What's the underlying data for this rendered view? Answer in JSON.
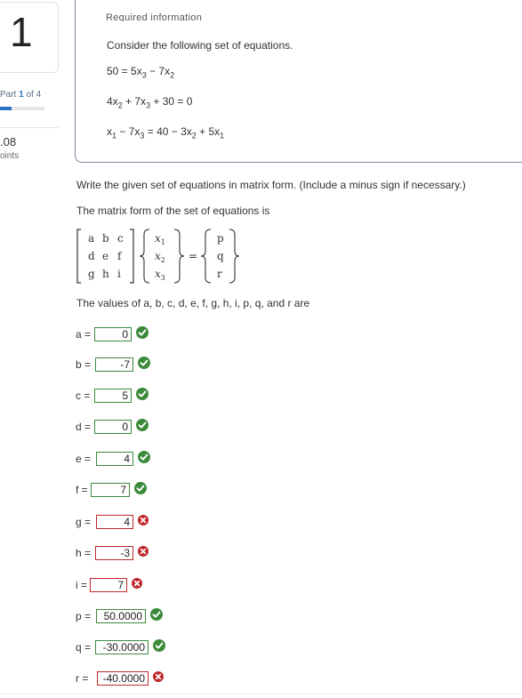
{
  "sidebar": {
    "question_number": "1",
    "part_word": "Part",
    "part_current": "1",
    "part_of": "of 4",
    "progress_fraction": 0.25,
    "points_value": ".08",
    "points_label": "oints"
  },
  "info": {
    "header": "Required information",
    "intro": "Consider the following set of equations.",
    "equations": {
      "eq1": {
        "lhs": "50 = 5x",
        "s1": "3",
        "mid": " − 7x",
        "s2": "2"
      },
      "eq2": {
        "a": "4x",
        "s1": "2",
        "b": " + 7x",
        "s2": "3",
        "c": " + 30 = 0"
      },
      "eq3": {
        "a": "x",
        "s1": "1",
        "b": " − 7x",
        "s2": "3",
        "c": " = 40 − 3x",
        "s3": "2",
        "d": " + 5x",
        "s4": "1"
      }
    }
  },
  "question": {
    "instruction": "Write the given set of equations in matrix form. (Include a minus sign if necessary.)",
    "matrix_intro": "The matrix form of the set of equations is",
    "values_prompt": "The values of a, b, c, d, e, f, g, h, i, p, q, and r are"
  },
  "matrix": {
    "coeffs": [
      "a",
      "b",
      "c",
      "d",
      "e",
      "f",
      "g",
      "h",
      "i"
    ],
    "vars": [
      {
        "v": "x",
        "s": "1"
      },
      {
        "v": "x",
        "s": "2"
      },
      {
        "v": "x",
        "s": "3"
      }
    ],
    "equals": "=",
    "rhs": [
      "p",
      "q",
      "r"
    ]
  },
  "answers": [
    {
      "label": "a =",
      "value": "0",
      "correct": true
    },
    {
      "label": "b =",
      "value": "-7",
      "correct": true
    },
    {
      "label": "c =",
      "value": "5",
      "correct": true
    },
    {
      "label": "d =",
      "value": "0",
      "correct": true
    },
    {
      "label": "e =",
      "value": "4",
      "correct": true
    },
    {
      "label": "f =",
      "value": "7",
      "correct": true
    },
    {
      "label": "g =",
      "value": "4",
      "correct": false
    },
    {
      "label": "h =",
      "value": "-3",
      "correct": false
    },
    {
      "label": "i =",
      "value": "7",
      "correct": false
    },
    {
      "label": "p =",
      "value": "50.0000",
      "correct": true
    },
    {
      "label": "q =",
      "value": "-30.0000",
      "correct": true
    },
    {
      "label": "r =",
      "value": "-40.0000",
      "correct": false
    }
  ],
  "colors": {
    "correct": "#3a8a3a",
    "incorrect": "#c0282a",
    "accent": "#2a72c3"
  }
}
